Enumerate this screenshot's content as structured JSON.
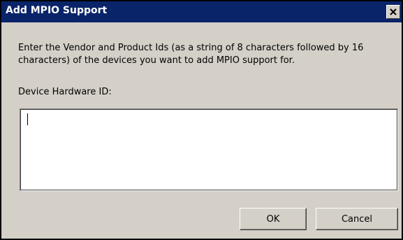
{
  "window": {
    "title": "Add MPIO Support",
    "close_icon": "close-icon"
  },
  "content": {
    "instructions": "Enter the Vendor and Product Ids (as a string of 8 characters followed by 16 characters) of the devices you want to add MPIO support for.",
    "field_label": "Device Hardware ID:",
    "field_value": ""
  },
  "buttons": {
    "ok_label": "OK",
    "cancel_label": "Cancel"
  },
  "colors": {
    "title_bar": "#0a246a",
    "dialog_face": "#d4d0c8",
    "title_text": "#ffffff"
  }
}
